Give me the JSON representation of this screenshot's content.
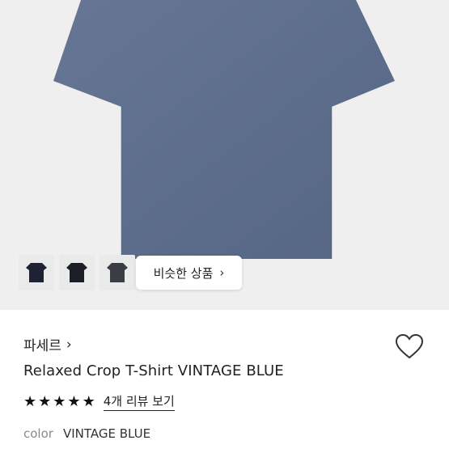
{
  "product_image": {
    "thumbnails": [
      {
        "icon": "tshirt-navy-thumbnail",
        "color": "#1f2233"
      },
      {
        "icon": "tshirt-black-thumbnail",
        "color": "#1c1f27"
      },
      {
        "icon": "tshirt-charcoal-thumbnail",
        "color": "#3a3e44"
      }
    ],
    "similar_button_label": "비슷한 상품",
    "similar_button_chevron": "›",
    "shirt_color": "#5b6b8c"
  },
  "product": {
    "brand": "파세르",
    "brand_chevron": "›",
    "title": "Relaxed Crop T-Shirt VINTAGE BLUE",
    "rating_stars": 5,
    "stars": [
      "★",
      "★",
      "★",
      "★",
      "★"
    ],
    "reviews_link": "4개 리뷰 보기",
    "color_label": "color",
    "color_value": "VINTAGE BLUE"
  }
}
